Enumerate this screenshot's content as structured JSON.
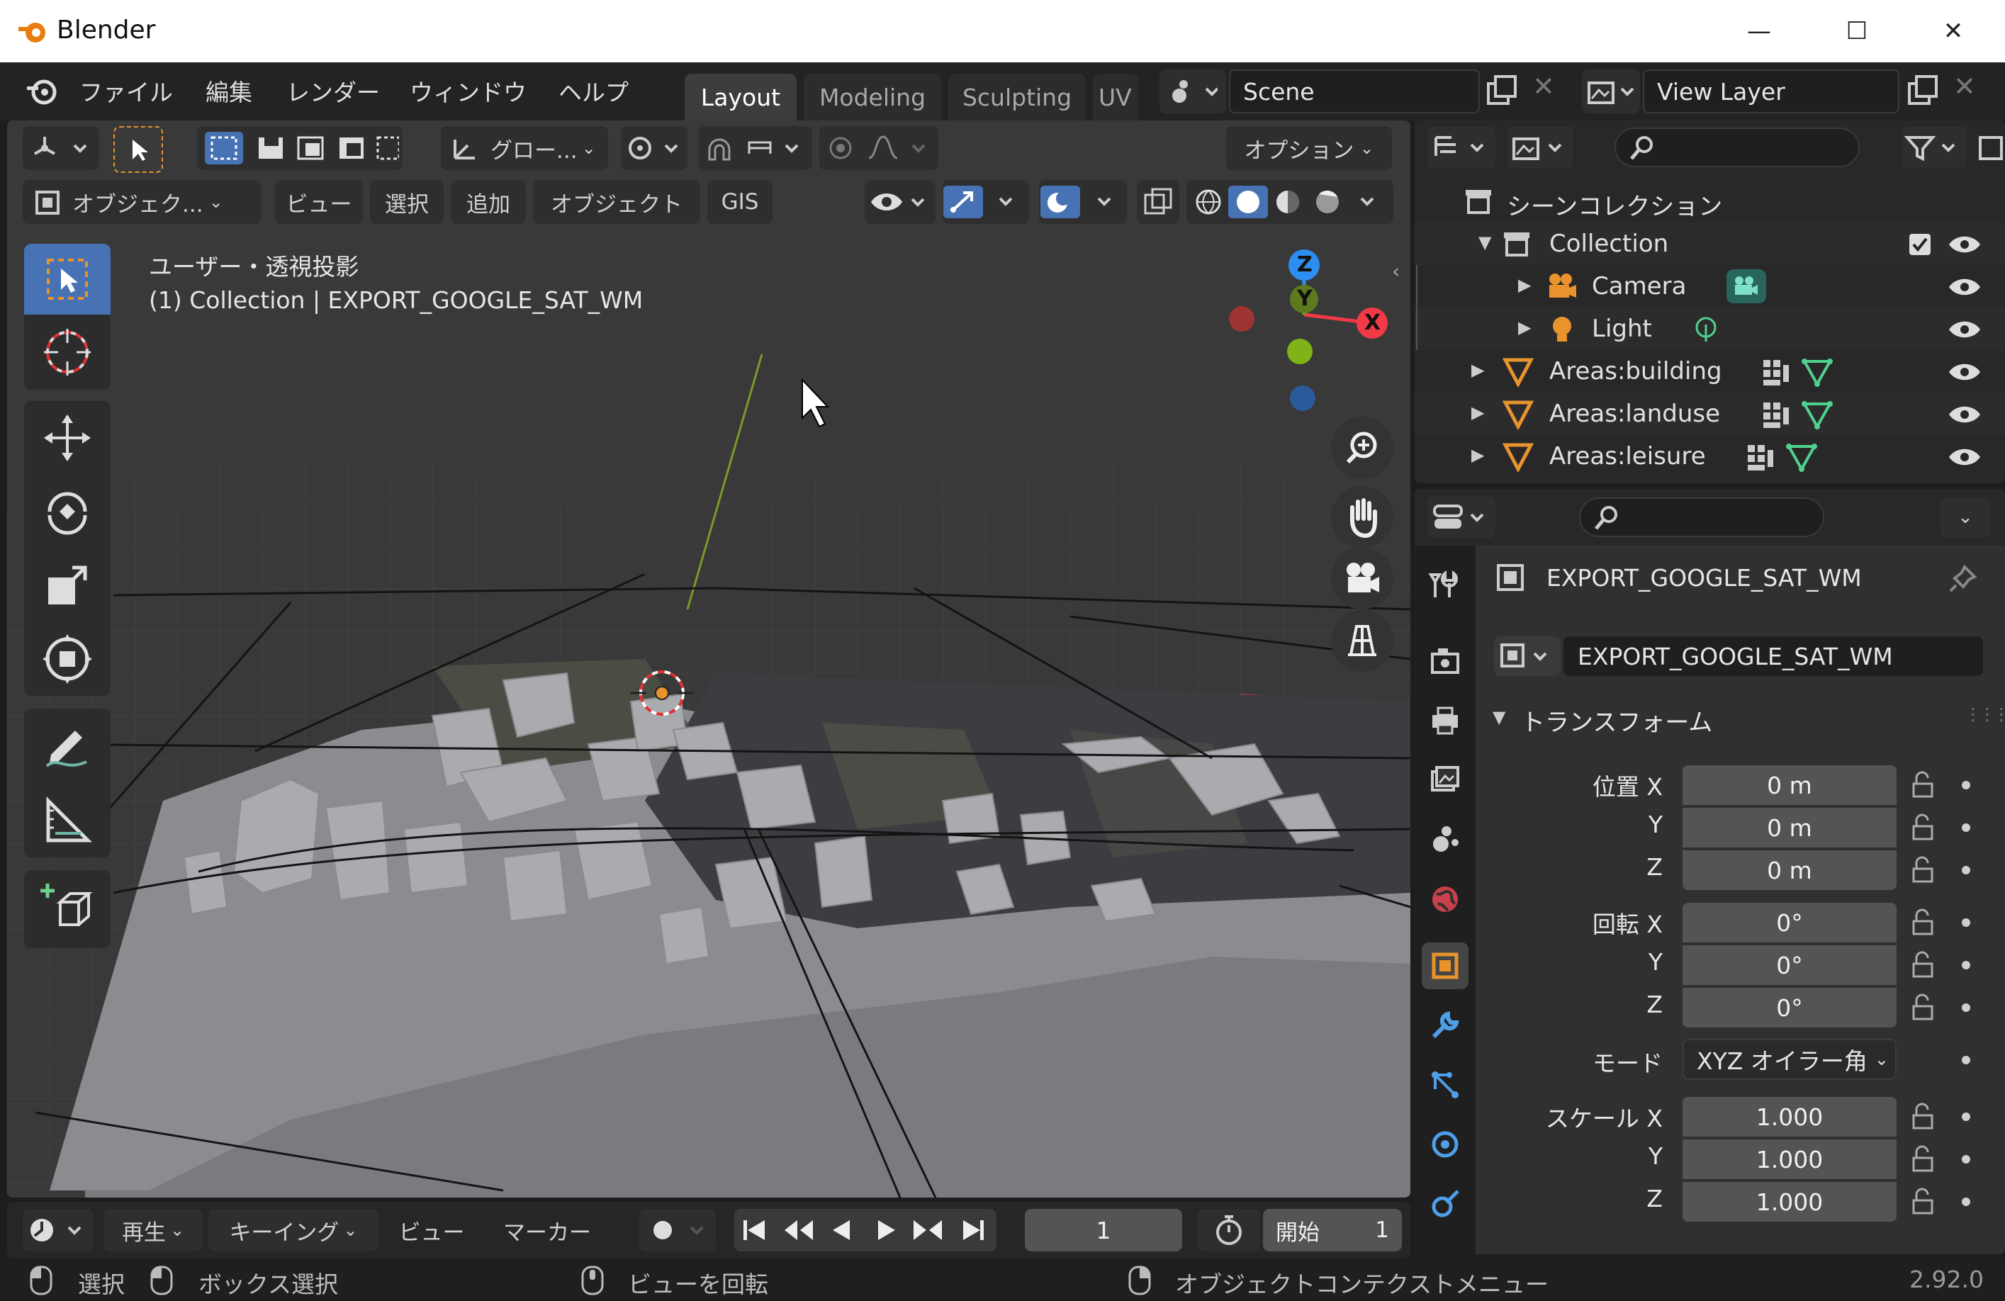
{
  "window": {
    "title": "Blender",
    "minimize": "—",
    "maximize": "☐",
    "close": "✕"
  },
  "menu": {
    "items": [
      "ファイル",
      "編集",
      "レンダー",
      "ウィンドウ",
      "ヘルプ"
    ],
    "workspaces": [
      "Layout",
      "Modeling",
      "Sculpting",
      "UV"
    ],
    "active_workspace": "Layout",
    "scene": "Scene",
    "view_layer": "View Layer"
  },
  "viewport": {
    "transform_orientation": "グロー...",
    "options": "オプション",
    "mode": "オブジェク...",
    "menus": [
      "ビュー",
      "選択",
      "追加",
      "オブジェクト",
      "GIS"
    ],
    "view_name": "ユーザー・透視投影",
    "object_info": "(1) Collection | EXPORT_GOOGLE_SAT_WM",
    "gizmo": {
      "z": "Z",
      "y": "Y",
      "x": "X"
    }
  },
  "outliner": {
    "root": "シーンコレクション",
    "collection": "Collection",
    "items": [
      {
        "name": "Camera"
      },
      {
        "name": "Light"
      },
      {
        "name": "Areas:building"
      },
      {
        "name": "Areas:landuse"
      },
      {
        "name": "Areas:leisure"
      }
    ]
  },
  "properties": {
    "object_name": "EXPORT_GOOGLE_SAT_WM",
    "datablock_name": "EXPORT_GOOGLE_SAT_WM",
    "panel_title": "トランスフォーム",
    "location_label": "位置 X",
    "rotation_label": "回転 X",
    "scale_label": "スケール X",
    "axis_y": "Y",
    "axis_z": "Z",
    "location": [
      "0 m",
      "0 m",
      "0 m"
    ],
    "rotation": [
      "0°",
      "0°",
      "0°"
    ],
    "mode_label": "モード",
    "mode_value": "XYZ オイラー角",
    "scale": [
      "1.000",
      "1.000",
      "1.000"
    ]
  },
  "timeline": {
    "menus": [
      "再生",
      "キーイング",
      "ビュー",
      "マーカー"
    ],
    "current_frame": "1",
    "start_label": "開始",
    "start_value": "1"
  },
  "status": {
    "select": "選択",
    "box_select": "ボックス選択",
    "rotate_view": "ビューを回転",
    "context_menu": "オブジェクトコンテクストメニュー",
    "version": "2.92.0"
  },
  "colors": {
    "accent": "#4772b3",
    "active_orange": "#e8932c",
    "axis_x": "#f03a47",
    "axis_y": "#7fb318",
    "axis_z": "#2c8ef0"
  }
}
